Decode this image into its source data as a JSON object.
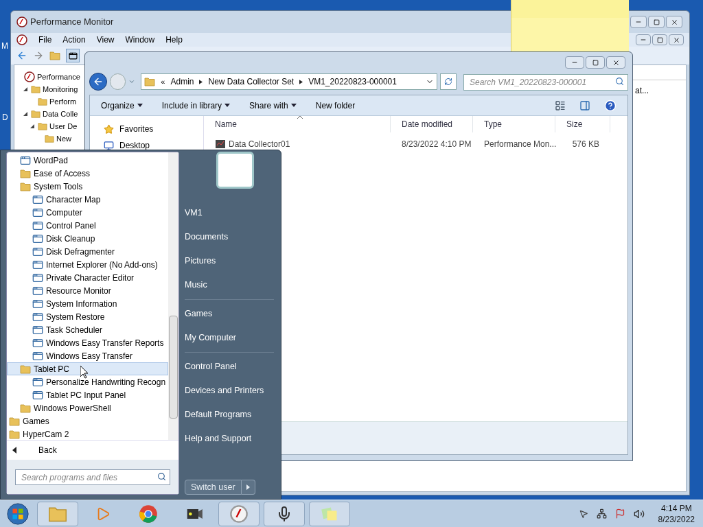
{
  "desktop": {
    "icon_labels": [
      "M",
      "D"
    ]
  },
  "perfmon": {
    "title": "Performance Monitor",
    "menu": [
      "File",
      "Action",
      "View",
      "Window",
      "Help"
    ],
    "tree": [
      {
        "label": "Performance",
        "children": [
          {
            "label": "Monitoring",
            "expanded": true,
            "children": [
              {
                "label": "Perform"
              }
            ]
          },
          {
            "label": "Data Colle",
            "expanded": true,
            "children": [
              {
                "label": "User De",
                "expanded": true,
                "children": [
                  {
                    "label": "New"
                  }
                ]
              }
            ]
          }
        ]
      }
    ],
    "pane_text": "at..."
  },
  "explorer": {
    "overflow_marker": "«",
    "breadcrumb": [
      "Admin",
      "New Data Collector Set",
      "VM1_20220823-000001"
    ],
    "search_placeholder": "Search VM1_20220823-000001",
    "toolbar": [
      {
        "label": "Organize",
        "has_menu": true
      },
      {
        "label": "Include in library",
        "has_menu": true
      },
      {
        "label": "Share with",
        "has_menu": true
      },
      {
        "label": "New folder",
        "has_menu": false
      }
    ],
    "nav": [
      {
        "label": "Favorites",
        "kind": "favorites"
      },
      {
        "label": "Desktop",
        "kind": "desktop"
      }
    ],
    "columns": [
      {
        "label": "Name",
        "sorted": true
      },
      {
        "label": "Date modified",
        "sorted": false
      },
      {
        "label": "Type",
        "sorted": false
      },
      {
        "label": "Size",
        "sorted": false
      }
    ],
    "files": [
      {
        "name": "Data Collector01",
        "date": "8/23/2022 4:10 PM",
        "type": "Performance Mon...",
        "size": "576 KB"
      }
    ]
  },
  "start_menu": {
    "programs": [
      {
        "label": "WordPad",
        "kind": "app",
        "selected": false
      },
      {
        "label": "Ease of Access",
        "kind": "folder",
        "selected": false
      },
      {
        "label": "System Tools",
        "kind": "folder",
        "selected": false,
        "children": [
          {
            "label": "Character Map",
            "kind": "app",
            "selected": false
          },
          {
            "label": "Computer",
            "kind": "app",
            "selected": false
          },
          {
            "label": "Control Panel",
            "kind": "app",
            "selected": false
          },
          {
            "label": "Disk Cleanup",
            "kind": "app",
            "selected": false
          },
          {
            "label": "Disk Defragmenter",
            "kind": "app",
            "selected": false
          },
          {
            "label": "Internet Explorer (No Add-ons)",
            "kind": "app",
            "selected": false
          },
          {
            "label": "Private Character Editor",
            "kind": "app",
            "selected": false
          },
          {
            "label": "Resource Monitor",
            "kind": "app",
            "selected": false
          },
          {
            "label": "System Information",
            "kind": "app",
            "selected": false
          },
          {
            "label": "System Restore",
            "kind": "app",
            "selected": false
          },
          {
            "label": "Task Scheduler",
            "kind": "app",
            "selected": false
          },
          {
            "label": "Windows Easy Transfer Reports",
            "kind": "app",
            "selected": false
          },
          {
            "label": "Windows Easy Transfer",
            "kind": "app",
            "selected": false
          }
        ]
      },
      {
        "label": "Tablet PC",
        "kind": "folder",
        "selected": true,
        "children": [
          {
            "label": "Personalize Handwriting Recogn",
            "kind": "app",
            "selected": false
          },
          {
            "label": "Tablet PC Input Panel",
            "kind": "app",
            "selected": false
          }
        ]
      },
      {
        "label": "Windows PowerShell",
        "kind": "folder",
        "selected": false
      }
    ],
    "top_programs": [
      {
        "label": "Games",
        "kind": "folder",
        "selected": false
      },
      {
        "label": "HyperCam 2",
        "kind": "folder",
        "selected": false
      }
    ],
    "back": "Back",
    "search_placeholder": "Search programs and files",
    "places": [
      [
        "VM1",
        "Documents",
        "Pictures",
        "Music"
      ],
      [
        "Games",
        "My Computer"
      ],
      [
        "Control Panel",
        "Devices and Printers",
        "Default Programs",
        "Help and Support"
      ]
    ],
    "switch_user": "Switch user"
  },
  "taskbar": {
    "buttons": [
      {
        "kind": "explorer",
        "open": true
      },
      {
        "kind": "media",
        "open": false
      },
      {
        "kind": "browser",
        "open": false
      },
      {
        "kind": "camera",
        "open": false
      },
      {
        "kind": "perfmon",
        "open": true
      },
      {
        "kind": "microphone",
        "open": true
      },
      {
        "kind": "notes",
        "open": true
      }
    ],
    "time": "4:14 PM",
    "date": "8/23/2022"
  }
}
